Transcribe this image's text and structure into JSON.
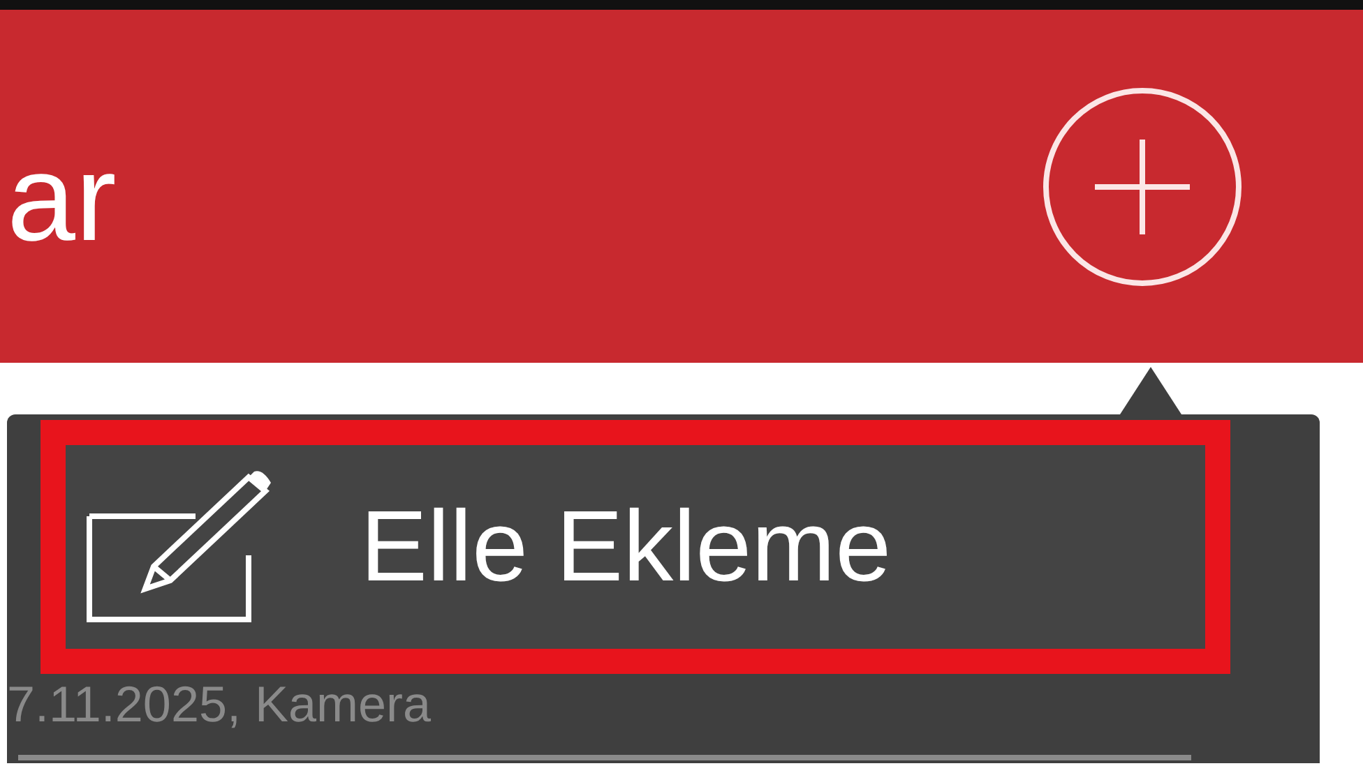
{
  "header": {
    "title": "ar"
  },
  "menu": {
    "items": [
      {
        "label": "Elle Ekleme",
        "highlighted": true
      }
    ]
  },
  "list_row": {
    "text": "7.11.2025, Kamera"
  }
}
